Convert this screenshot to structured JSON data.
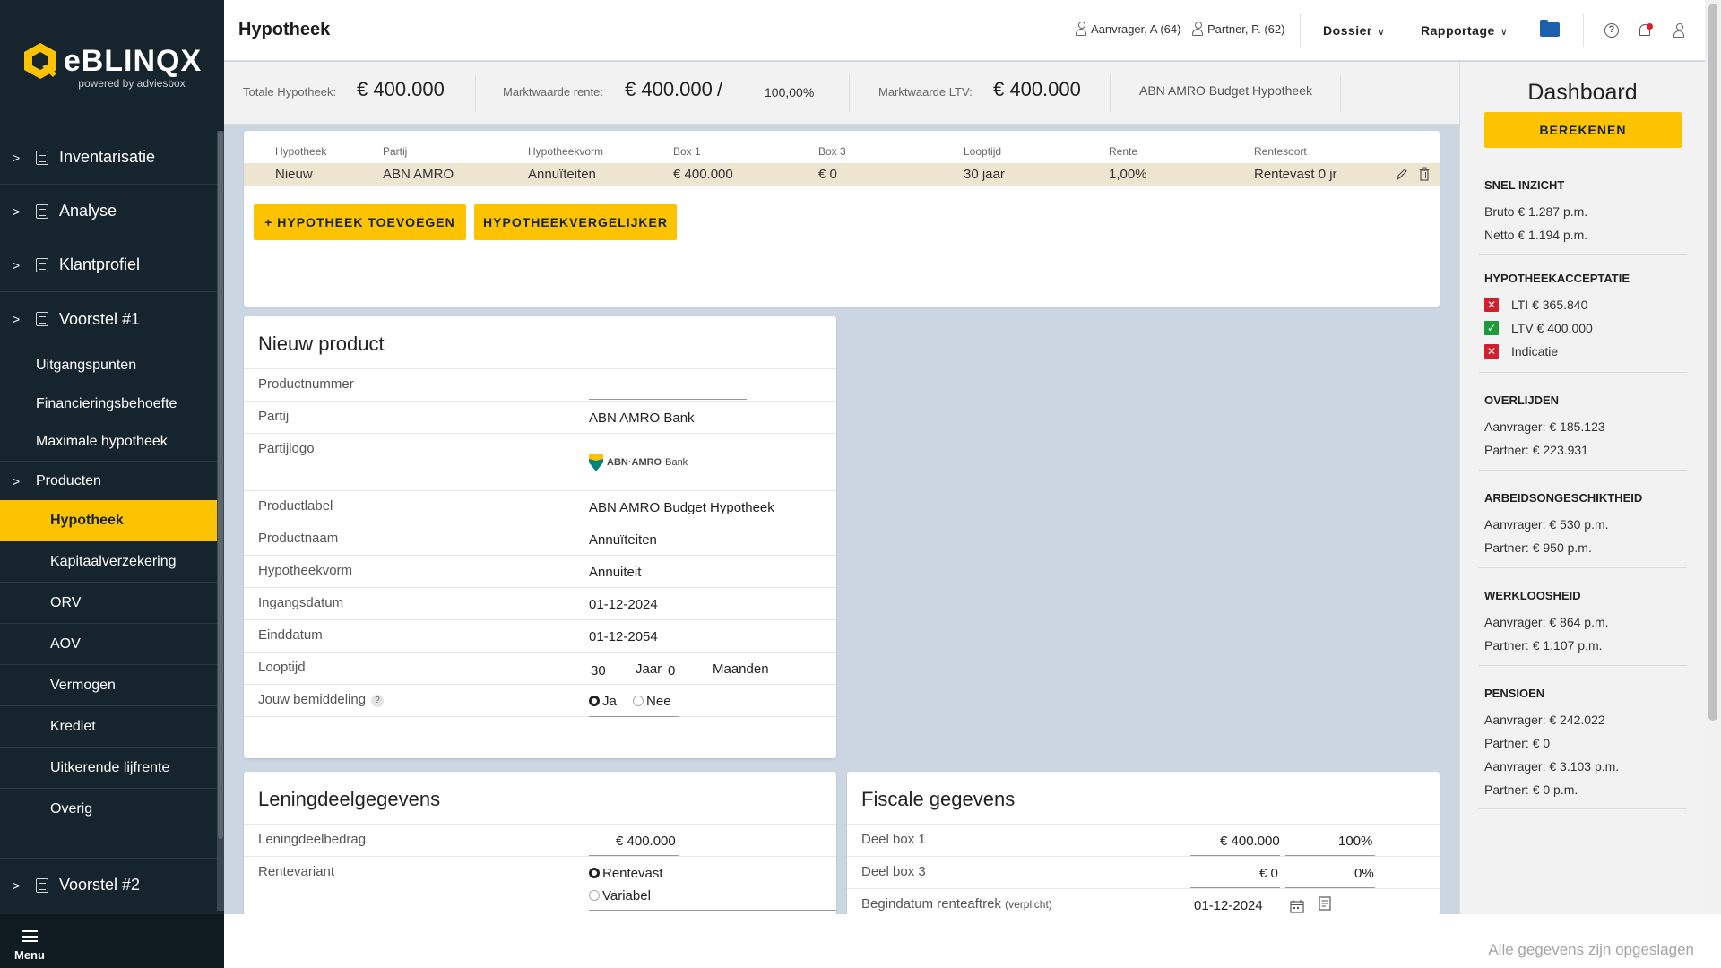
{
  "brand": {
    "name": "BLINQX",
    "prefix": "e",
    "tagline": "powered by adviesbox",
    "color": "#fdc300"
  },
  "sidebar": {
    "main_items": [
      {
        "label": "Inventarisatie"
      },
      {
        "label": "Analyse"
      },
      {
        "label": "Klantprofiel"
      },
      {
        "label": "Voorstel #1"
      }
    ],
    "sub_items": [
      "Uitgangspunten",
      "Financieringsbehoefte",
      "Maximale hypotheek"
    ],
    "products_label": "Producten",
    "products": [
      "Hypotheek",
      "Kapitaalverzekering",
      "ORV",
      "AOV",
      "Vermogen",
      "Krediet",
      "Uitkerende lijfrente",
      "Overig"
    ],
    "active_product": "Hypotheek",
    "voorstel2": "Voorstel #2",
    "menu_label": "Menu"
  },
  "topbar": {
    "title": "Hypotheek",
    "applicant": "Aanvrager, A (64)",
    "partner": "Partner, P. (62)",
    "dossier": "Dossier",
    "rapportage": "Rapportage",
    "help_symbol": "?"
  },
  "summary": {
    "total_label": "Totale Hypotheek:",
    "total_value": "€ 400.000",
    "market_rate_label": "Marktwaarde rente:",
    "market_rate_value": "€ 400.000",
    "slash": "/",
    "percentage": "100,00%",
    "ltv_label": "Marktwaarde LTV:",
    "ltv_value": "€ 400.000",
    "product_name": "ABN AMRO Budget Hypotheek"
  },
  "loans_table": {
    "headers": [
      "Hypotheek",
      "Partij",
      "Hypotheekvorm",
      "Box 1",
      "Box 3",
      "Looptijd",
      "Rente",
      "Rentesoort"
    ],
    "rows": [
      [
        "Nieuw",
        "ABN AMRO",
        "Annuïteiten",
        "€ 400.000",
        "€ 0",
        "30 jaar",
        "1,00%",
        "Rentevast 0 jr"
      ]
    ],
    "add_button": "+ HYPOTHEEK TOEVOEGEN",
    "compare_button": "HYPOTHEEKVERGELIJKER"
  },
  "product": {
    "title": "Nieuw product",
    "fields": {
      "productnummer_label": "Productnummer",
      "productnummer_value": "",
      "partij_label": "Partij",
      "partij_value": "ABN AMRO Bank",
      "logo_label": "Partijlogo",
      "logo_text": "ABN·AMRO",
      "logo_text2": "Bank",
      "label_label": "Productlabel",
      "label_value": "ABN AMRO Budget Hypotheek",
      "naam_label": "Productnaam",
      "naam_value": "Annuïteiten",
      "vorm_label": "Hypotheekvorm",
      "vorm_value": "Annuiteit",
      "ingang_label": "Ingangsdatum",
      "ingang_value": "01-12-2024",
      "eind_label": "Einddatum",
      "eind_value": "01-12-2054",
      "looptijd_label": "Looptijd",
      "looptijd_jaar": "30",
      "jaar_unit": "Jaar",
      "looptijd_maanden": "0",
      "maanden_unit": "Maanden",
      "bemiddeling_label": "Jouw bemiddeling",
      "bemiddeling_help": "?",
      "ja": "Ja",
      "nee": "Nee"
    }
  },
  "loanpart": {
    "title": "Leningdeelgegevens",
    "bedrag_label": "Leningdeelbedrag",
    "bedrag_value": "€ 400.000",
    "variant_label": "Rentevariant",
    "option1": "Rentevast",
    "option2": "Variabel"
  },
  "fiscal": {
    "title": "Fiscale gegevens",
    "box1_label": "Deel box 1",
    "box1_value": "€ 400.000",
    "box1_pct": "100%",
    "box3_label": "Deel box 3",
    "box3_value": "€ 0",
    "box3_pct": "0%",
    "begin_label": "Begindatum renteaftrek",
    "begin_note": "(verplicht)",
    "begin_value": "01-12-2024"
  },
  "dashboard": {
    "title": "Dashboard",
    "calc_button": "BEREKENEN",
    "snel_head": "SNEL INZICHT",
    "snel": [
      "Bruto € 1.287 p.m.",
      "Netto € 1.194 p.m."
    ],
    "acc_head": "HYPOTHEEKACCEPTATIE",
    "acc": [
      {
        "status": "fail",
        "label": "LTI € 365.840"
      },
      {
        "status": "ok",
        "label": "LTV € 400.000"
      },
      {
        "status": "fail",
        "label": "Indicatie"
      }
    ],
    "overl_head": "OVERLIJDEN",
    "overl": [
      "Aanvrager: € 185.123",
      "Partner: € 223.931"
    ],
    "arb_head": "ARBEIDSONGESCHIKTHEID",
    "arb": [
      "Aanvrager: € 530 p.m.",
      "Partner: € 950 p.m."
    ],
    "werk_head": "WERKLOOSHEID",
    "werk": [
      "Aanvrager: € 864 p.m.",
      "Partner: € 1.107 p.m."
    ],
    "pens_head": "PENSIOEN",
    "pens": [
      "Aanvrager: € 242.022",
      "Partner: € 0",
      "Aanvrager: € 3.103 p.m.",
      "Partner: € 0 p.m."
    ]
  },
  "footer": {
    "saved": "Alle gegevens zijn opgeslagen"
  }
}
